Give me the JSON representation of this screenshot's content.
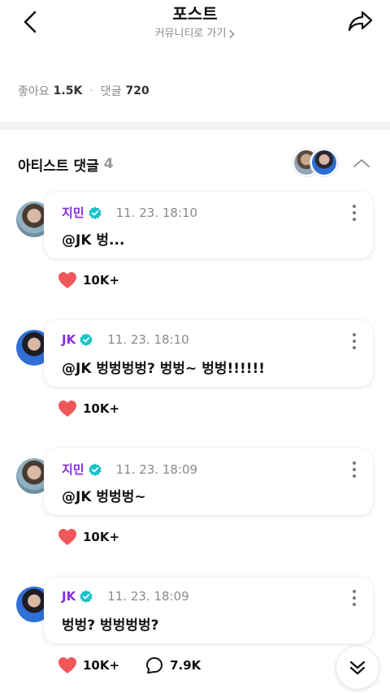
{
  "header": {
    "title": "포스트",
    "sub_link": "커뮤니티로 가기",
    "back_icon": "chevron-left-icon",
    "share_icon": "share-arrow-icon"
  },
  "stats": {
    "likes_label": "좋아요",
    "likes_value": "1.5K",
    "comments_label": "댓글",
    "comments_value": "720"
  },
  "artist_section": {
    "title": "아티스트 댓글",
    "count": "4"
  },
  "accent_color": "#8a2be2",
  "verified_color": "#17c3c8",
  "heart_color": "#f0575b",
  "comments": [
    {
      "name": "지민",
      "time": "11. 23. 18:10",
      "text": "@JK 벙...",
      "likes": "10K+",
      "replies": ""
    },
    {
      "name": "JK",
      "time": "11. 23. 18:10",
      "text": "@JK 벙벙벙벙? 벙벙~ 벙벙!!!!!!",
      "likes": "10K+",
      "replies": ""
    },
    {
      "name": "지민",
      "time": "11. 23. 18:09",
      "text": "@JK 벙벙벙~",
      "likes": "10K+",
      "replies": ""
    },
    {
      "name": "JK",
      "time": "11. 23. 18:09",
      "text": "벙벙? 벙벙벙벙?",
      "likes": "10K+",
      "replies": "7.9K"
    }
  ]
}
